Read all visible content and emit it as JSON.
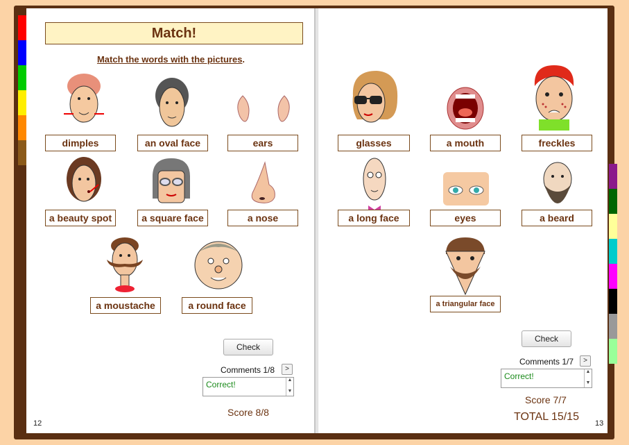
{
  "left_page": {
    "title": "Match!",
    "instruction": "Match the words with the pictures",
    "instruction_end": ".",
    "labels": [
      "dimples",
      "an oval face",
      "ears",
      "a beauty spot",
      "a square face",
      "a nose",
      "a moustache",
      "a round face"
    ],
    "check_label": "Check",
    "comments_label": "Comments 1/8",
    "next_label": ">",
    "comment_text": "Correct!",
    "score": "Score 8/8",
    "page_number": "12"
  },
  "right_page": {
    "labels": [
      "glasses",
      "a mouth",
      "freckles",
      "a long face",
      "eyes",
      "a beard",
      "a triangular face"
    ],
    "check_label": "Check",
    "comments_label": "Comments 1/7",
    "next_label": ">",
    "comment_text": "Correct!",
    "score": "Score 7/7",
    "total": "TOTAL 15/15",
    "page_number": "13"
  },
  "colors": {
    "background": "#fcd3a6",
    "book_cover": "#5a2f12",
    "title_fill": "#fff3c4",
    "text_brown": "#6b3311",
    "correct_green": "#1a8a1a",
    "left_tabs": [
      "#ff0000",
      "#0000ff",
      "#00cc00",
      "#ffee00",
      "#ff8800",
      "#8b5a1a"
    ],
    "right_tabs": [
      "#8b1a8b",
      "#006600",
      "#ffff99",
      "#00cccc",
      "#ff00ff",
      "#000000",
      "#999999",
      "#99ff99"
    ]
  },
  "icons": [
    "dimples-face-icon",
    "oval-face-icon",
    "ears-icon",
    "beauty-spot-face-icon",
    "square-face-icon",
    "nose-icon",
    "moustache-face-icon",
    "round-face-icon",
    "glasses-face-icon",
    "mouth-icon",
    "freckles-face-icon",
    "long-face-icon",
    "eyes-icon",
    "beard-face-icon",
    "triangular-face-icon"
  ]
}
